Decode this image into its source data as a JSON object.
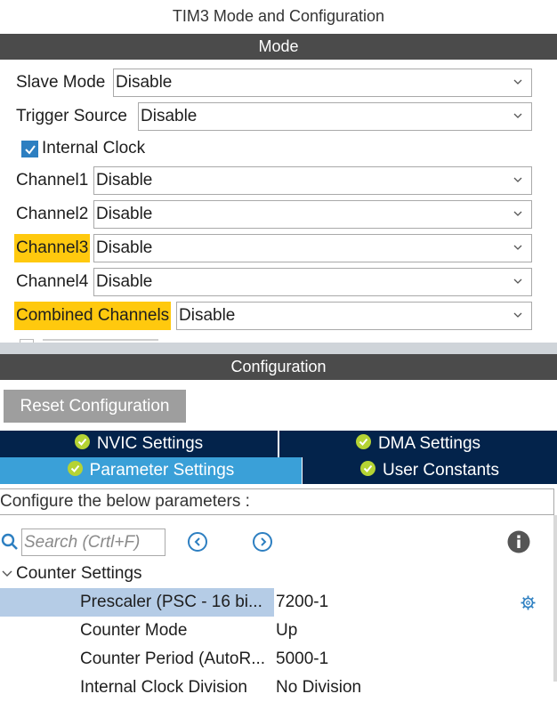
{
  "window": {
    "title": "TIM3 Mode and Configuration"
  },
  "mode": {
    "header": "Mode",
    "slave_mode": {
      "label": "Slave Mode",
      "value": "Disable"
    },
    "trigger_source": {
      "label": "Trigger Source",
      "value": "Disable"
    },
    "internal_clock": {
      "label": "Internal Clock",
      "checked": true
    },
    "channel1": {
      "label": "Channel1",
      "value": "Disable"
    },
    "channel2": {
      "label": "Channel2",
      "value": "Disable"
    },
    "channel3": {
      "label": "Channel3",
      "value": "Disable",
      "highlight": true
    },
    "channel4": {
      "label": "Channel4",
      "value": "Disable"
    },
    "combined_channels": {
      "label": "Combined Channels",
      "value": "Disable",
      "highlight": true
    }
  },
  "configuration": {
    "header": "Configuration",
    "reset_label": "Reset Configuration",
    "tabs": {
      "nvic": "NVIC Settings",
      "dma": "DMA Settings",
      "parameter": "Parameter Settings",
      "user_constants": "User Constants"
    },
    "description": "Configure the below parameters :",
    "search_placeholder": "Search (Crtl+F)",
    "counter_settings": {
      "group_label": "Counter Settings",
      "rows": [
        {
          "name": "Prescaler (PSC - 16 bi...",
          "value": "7200-1"
        },
        {
          "name": "Counter Mode",
          "value": "Up"
        },
        {
          "name": "Counter Period (AutoR...",
          "value": "5000-1"
        },
        {
          "name": "Internal Clock Division",
          "value": "No Division"
        }
      ]
    }
  },
  "colors": {
    "section_bar": "#4b4b4b",
    "highlight": "#ffc90e",
    "tab_dark": "#03234b",
    "tab_active": "#3aa0d8",
    "ok_badge": "#b5d334",
    "selected_row": "#b5cce6",
    "accent": "#2d7fc1"
  }
}
